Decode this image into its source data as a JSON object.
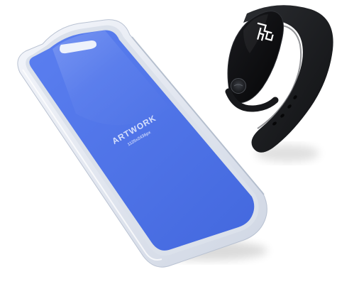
{
  "mockup": {
    "phone": {
      "screen_title": "ARTWORK",
      "screen_subtitle": "1125x2436px",
      "screen_color": "#4d73e6"
    },
    "band": {
      "logo_icon": "band-logo-icon",
      "button_icon": "band-button-icon"
    }
  }
}
